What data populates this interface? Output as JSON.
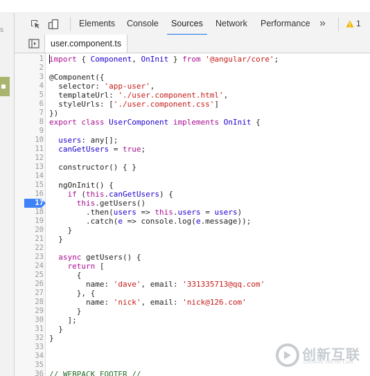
{
  "page": {
    "left_hint": "s"
  },
  "toolbar": {
    "tabs": [
      {
        "label": "Elements"
      },
      {
        "label": "Console"
      },
      {
        "label": "Sources"
      },
      {
        "label": "Network"
      },
      {
        "label": "Performance"
      }
    ],
    "more_label": "»",
    "warnings_count": "1"
  },
  "file_tab": {
    "label": "user.component.ts"
  },
  "editor": {
    "breakpoint_line": "17",
    "lines": [
      {
        "n": "1",
        "t": "import { Component, OnInit } from '@angular/core';"
      },
      {
        "n": "2",
        "t": ""
      },
      {
        "n": "3",
        "t": "@Component({"
      },
      {
        "n": "4",
        "t": "  selector: 'app-user',"
      },
      {
        "n": "5",
        "t": "  templateUrl: './user.component.html',"
      },
      {
        "n": "6",
        "t": "  styleUrls: ['./user.component.css']"
      },
      {
        "n": "7",
        "t": "})"
      },
      {
        "n": "8",
        "t": "export class UserComponent implements OnInit {"
      },
      {
        "n": "9",
        "t": ""
      },
      {
        "n": "10",
        "t": "  users: any[];"
      },
      {
        "n": "11",
        "t": "  canGetUsers = true;"
      },
      {
        "n": "12",
        "t": ""
      },
      {
        "n": "13",
        "t": "  constructor() { }"
      },
      {
        "n": "14",
        "t": ""
      },
      {
        "n": "15",
        "t": "  ngOnInit() {"
      },
      {
        "n": "16",
        "t": "    if (this.canGetUsers) {"
      },
      {
        "n": "17",
        "t": "      this.getUsers()"
      },
      {
        "n": "18",
        "t": "        .then(users => this.users = users)"
      },
      {
        "n": "19",
        "t": "        .catch(e => console.log(e.message));"
      },
      {
        "n": "20",
        "t": "    }"
      },
      {
        "n": "21",
        "t": "  }"
      },
      {
        "n": "22",
        "t": ""
      },
      {
        "n": "23",
        "t": "  async getUsers() {"
      },
      {
        "n": "24",
        "t": "    return ["
      },
      {
        "n": "25",
        "t": "      {"
      },
      {
        "n": "26",
        "t": "        name: 'dave', email: '331335713@qq.com'"
      },
      {
        "n": "27",
        "t": "      }, {"
      },
      {
        "n": "28",
        "t": "        name: 'nick', email: 'nick@126.com'"
      },
      {
        "n": "29",
        "t": "      }"
      },
      {
        "n": "30",
        "t": "    ];"
      },
      {
        "n": "31",
        "t": "  }"
      },
      {
        "n": "32",
        "t": "}"
      },
      {
        "n": "33",
        "t": ""
      },
      {
        "n": "34",
        "t": ""
      },
      {
        "n": "35",
        "t": ""
      },
      {
        "n": "36",
        "t": "// WEBPACK FOOTER //"
      }
    ]
  },
  "watermark": {
    "title": "创新互联",
    "subtitle": "CHUANG XIN HU LIAN"
  },
  "colors": {
    "active_tab_underline": "#1a73e8",
    "breakpoint": "#3e82f7",
    "keyword": "#aa0d91",
    "identifier": "#1c00cf",
    "string": "#c41a16",
    "comment": "#236e25",
    "warning": "#f4b400"
  },
  "icons": [
    "inspect-element-icon",
    "device-toolbar-icon",
    "warning-icon",
    "navigator-toggle-icon",
    "breakpoint-marker-icon"
  ]
}
